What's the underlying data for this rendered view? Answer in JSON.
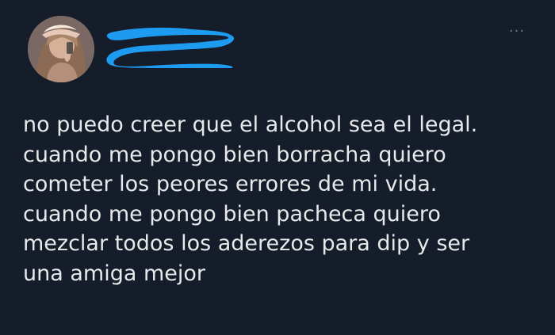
{
  "tweet": {
    "more_icon_label": "···",
    "text": "no puedo creer que el alcohol sea el legal.\ncuando me pongo bien borracha quiero\ncometer los peores errores de mi vida.\ncuando me pongo bien pacheca quiero\nmezclar todos los aderezos para dip y ser\nuna amiga mejor"
  },
  "icons": {
    "avatar": "profile-avatar",
    "redaction": "blue-scribble",
    "more": "ellipsis-icon"
  },
  "colors": {
    "background": "#151c2a",
    "text": "#e7e9ea",
    "muted": "#6f7b8d",
    "redaction": "#1d9bf0"
  }
}
